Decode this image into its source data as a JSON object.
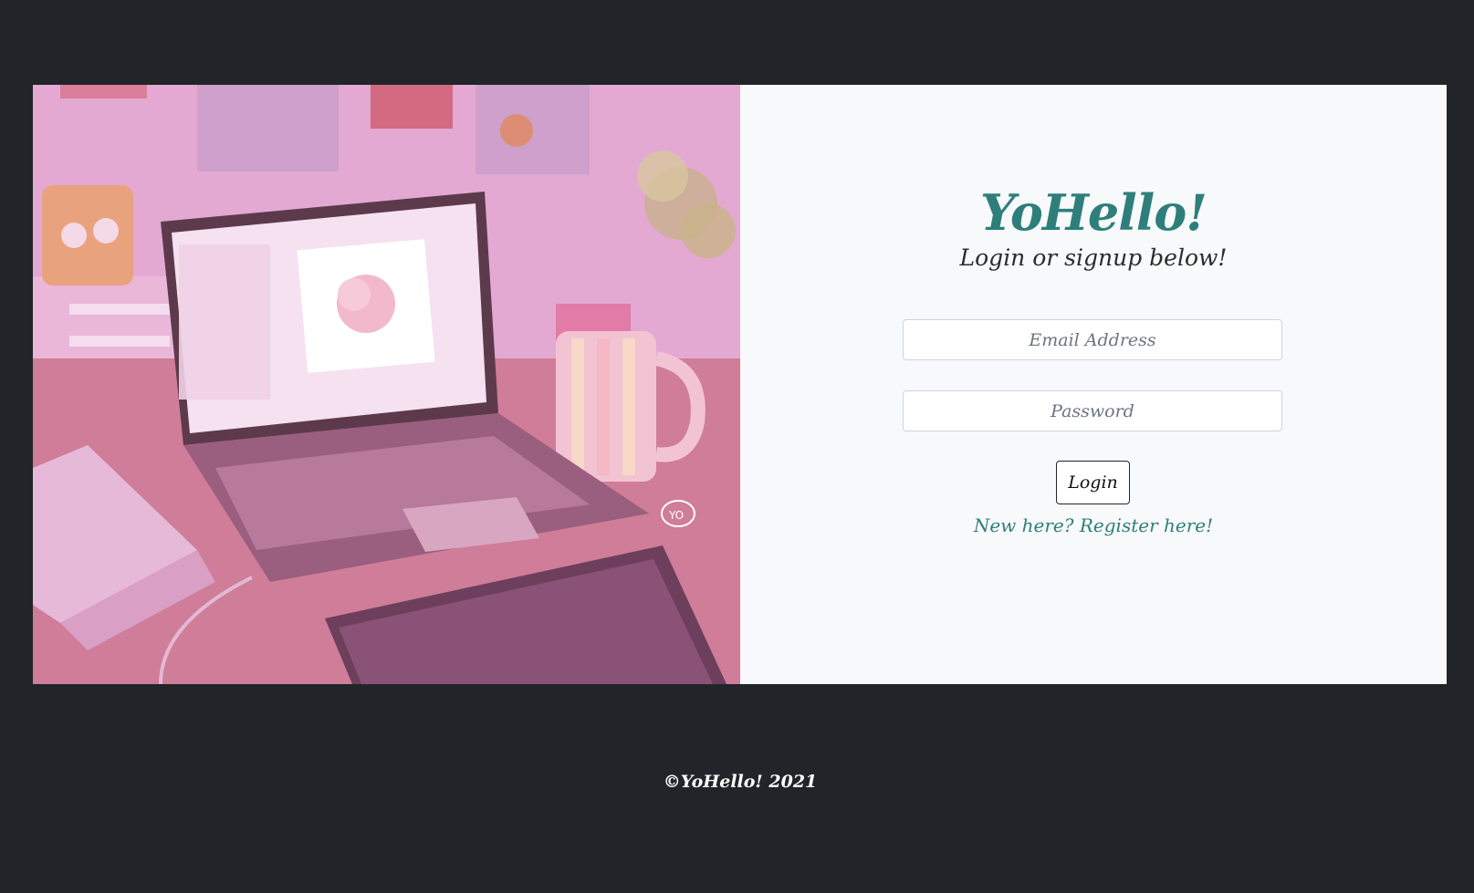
{
  "illustration": {
    "icon": "laptop-desk-illustration",
    "speech_bubble_text": "YO"
  },
  "login": {
    "brand": "YoHello!",
    "tagline": "Login or signup below!",
    "email_placeholder": "Email Address",
    "password_placeholder": "Password",
    "login_label": "Login",
    "register_link": "New here? Register here!"
  },
  "footer": {
    "copyright": "©YoHello! 2021"
  },
  "colors": {
    "page_background": "#212529",
    "panel_background": "#f8f9fa",
    "accent": "#2e7f7b"
  }
}
